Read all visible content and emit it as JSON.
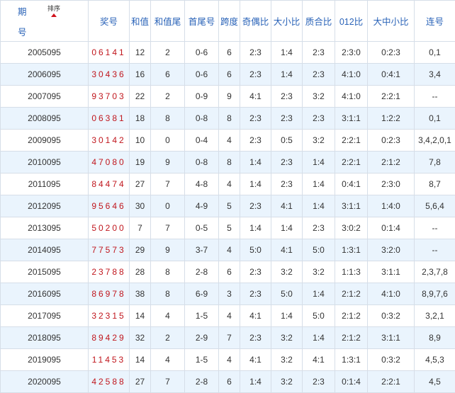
{
  "header": {
    "period_char1": "期",
    "period_char2": "号",
    "sort_label": "排序",
    "columns": [
      "奖号",
      "和值",
      "和值尾",
      "首尾号",
      "跨度",
      "奇偶比",
      "大小比",
      "质合比",
      "012比",
      "大中小比",
      "连号"
    ]
  },
  "rows": [
    {
      "period": "2005095",
      "number": "06141",
      "sum": "12",
      "sum_tail": "2",
      "head_tail": "0-6",
      "span": "6",
      "odd_even": "2:3",
      "big_small": "1:4",
      "prime_comp": "2:3",
      "r012": "2:3:0",
      "big_mid_small": "0:2:3",
      "consecutive": "0,1"
    },
    {
      "period": "2006095",
      "number": "30436",
      "sum": "16",
      "sum_tail": "6",
      "head_tail": "0-6",
      "span": "6",
      "odd_even": "2:3",
      "big_small": "1:4",
      "prime_comp": "2:3",
      "r012": "4:1:0",
      "big_mid_small": "0:4:1",
      "consecutive": "3,4"
    },
    {
      "period": "2007095",
      "number": "93703",
      "sum": "22",
      "sum_tail": "2",
      "head_tail": "0-9",
      "span": "9",
      "odd_even": "4:1",
      "big_small": "2:3",
      "prime_comp": "3:2",
      "r012": "4:1:0",
      "big_mid_small": "2:2:1",
      "consecutive": "--"
    },
    {
      "period": "2008095",
      "number": "06381",
      "sum": "18",
      "sum_tail": "8",
      "head_tail": "0-8",
      "span": "8",
      "odd_even": "2:3",
      "big_small": "2:3",
      "prime_comp": "2:3",
      "r012": "3:1:1",
      "big_mid_small": "1:2:2",
      "consecutive": "0,1"
    },
    {
      "period": "2009095",
      "number": "30142",
      "sum": "10",
      "sum_tail": "0",
      "head_tail": "0-4",
      "span": "4",
      "odd_even": "2:3",
      "big_small": "0:5",
      "prime_comp": "3:2",
      "r012": "2:2:1",
      "big_mid_small": "0:2:3",
      "consecutive": "3,4,2,0,1"
    },
    {
      "period": "2010095",
      "number": "47080",
      "sum": "19",
      "sum_tail": "9",
      "head_tail": "0-8",
      "span": "8",
      "odd_even": "1:4",
      "big_small": "2:3",
      "prime_comp": "1:4",
      "r012": "2:2:1",
      "big_mid_small": "2:1:2",
      "consecutive": "7,8"
    },
    {
      "period": "2011095",
      "number": "84474",
      "sum": "27",
      "sum_tail": "7",
      "head_tail": "4-8",
      "span": "4",
      "odd_even": "1:4",
      "big_small": "2:3",
      "prime_comp": "1:4",
      "r012": "0:4:1",
      "big_mid_small": "2:3:0",
      "consecutive": "8,7"
    },
    {
      "period": "2012095",
      "number": "95646",
      "sum": "30",
      "sum_tail": "0",
      "head_tail": "4-9",
      "span": "5",
      "odd_even": "2:3",
      "big_small": "4:1",
      "prime_comp": "1:4",
      "r012": "3:1:1",
      "big_mid_small": "1:4:0",
      "consecutive": "5,6,4"
    },
    {
      "period": "2013095",
      "number": "50200",
      "sum": "7",
      "sum_tail": "7",
      "head_tail": "0-5",
      "span": "5",
      "odd_even": "1:4",
      "big_small": "1:4",
      "prime_comp": "2:3",
      "r012": "3:0:2",
      "big_mid_small": "0:1:4",
      "consecutive": "--"
    },
    {
      "period": "2014095",
      "number": "77573",
      "sum": "29",
      "sum_tail": "9",
      "head_tail": "3-7",
      "span": "4",
      "odd_even": "5:0",
      "big_small": "4:1",
      "prime_comp": "5:0",
      "r012": "1:3:1",
      "big_mid_small": "3:2:0",
      "consecutive": "--"
    },
    {
      "period": "2015095",
      "number": "23788",
      "sum": "28",
      "sum_tail": "8",
      "head_tail": "2-8",
      "span": "6",
      "odd_even": "2:3",
      "big_small": "3:2",
      "prime_comp": "3:2",
      "r012": "1:1:3",
      "big_mid_small": "3:1:1",
      "consecutive": "2,3,7,8"
    },
    {
      "period": "2016095",
      "number": "86978",
      "sum": "38",
      "sum_tail": "8",
      "head_tail": "6-9",
      "span": "3",
      "odd_even": "2:3",
      "big_small": "5:0",
      "prime_comp": "1:4",
      "r012": "2:1:2",
      "big_mid_small": "4:1:0",
      "consecutive": "8,9,7,6"
    },
    {
      "period": "2017095",
      "number": "32315",
      "sum": "14",
      "sum_tail": "4",
      "head_tail": "1-5",
      "span": "4",
      "odd_even": "4:1",
      "big_small": "1:4",
      "prime_comp": "5:0",
      "r012": "2:1:2",
      "big_mid_small": "0:3:2",
      "consecutive": "3,2,1"
    },
    {
      "period": "2018095",
      "number": "89429",
      "sum": "32",
      "sum_tail": "2",
      "head_tail": "2-9",
      "span": "7",
      "odd_even": "2:3",
      "big_small": "3:2",
      "prime_comp": "1:4",
      "r012": "2:1:2",
      "big_mid_small": "3:1:1",
      "consecutive": "8,9"
    },
    {
      "period": "2019095",
      "number": "11453",
      "sum": "14",
      "sum_tail": "4",
      "head_tail": "1-5",
      "span": "4",
      "odd_even": "4:1",
      "big_small": "3:2",
      "prime_comp": "4:1",
      "r012": "1:3:1",
      "big_mid_small": "0:3:2",
      "consecutive": "4,5,3"
    },
    {
      "period": "2020095",
      "number": "42588",
      "sum": "27",
      "sum_tail": "7",
      "head_tail": "2-8",
      "span": "6",
      "odd_even": "1:4",
      "big_small": "3:2",
      "prime_comp": "2:3",
      "r012": "0:1:4",
      "big_mid_small": "2:2:1",
      "consecutive": "4,5"
    }
  ]
}
